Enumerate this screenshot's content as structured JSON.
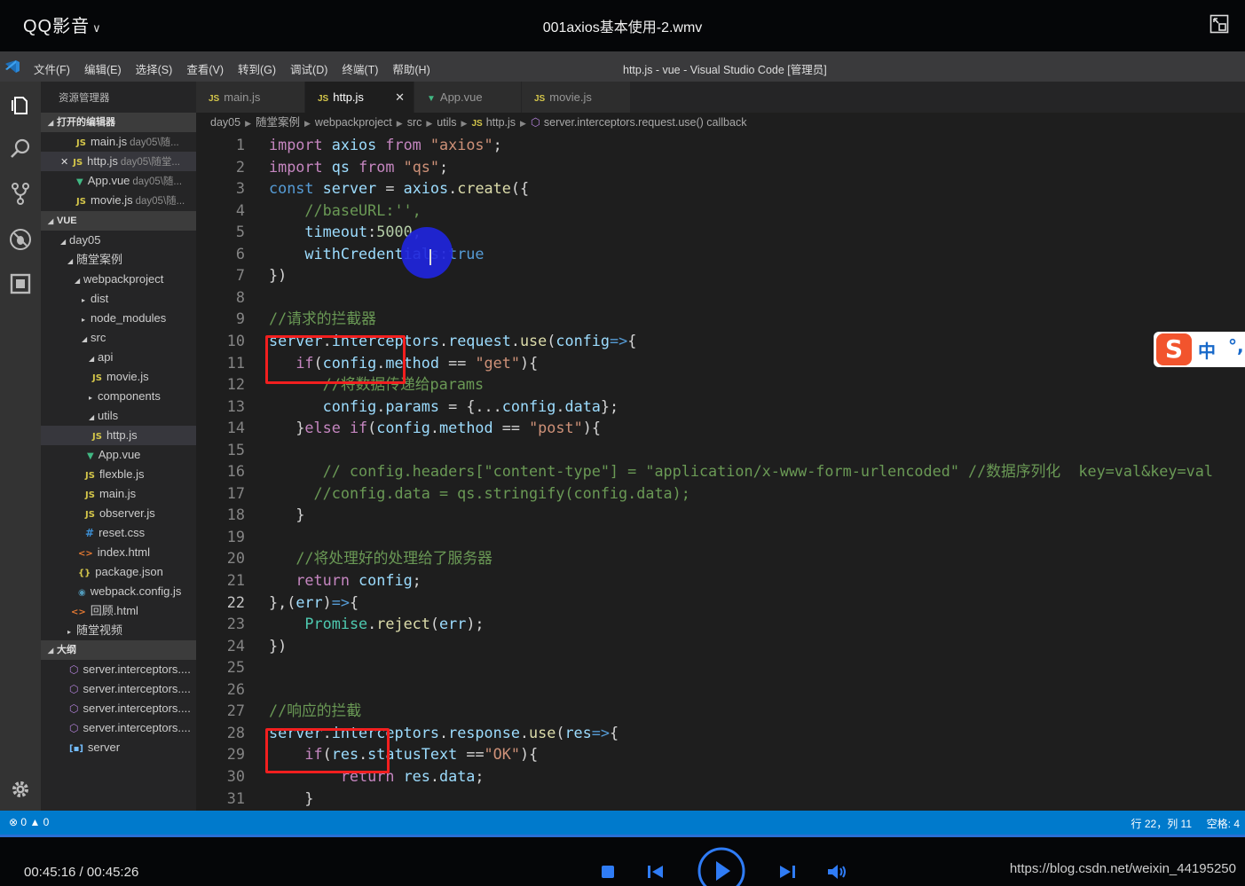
{
  "player": {
    "app_name": "QQ影音",
    "file_title": "001axios基本使用-2.wmv",
    "time_display": "00:45:16 / 00:45:26",
    "watermark": "https://blog.csdn.net/weixin_44195250"
  },
  "vscode": {
    "menu": [
      "文件(F)",
      "编辑(E)",
      "选择(S)",
      "查看(V)",
      "转到(G)",
      "调试(D)",
      "终端(T)",
      "帮助(H)"
    ],
    "window_title": "http.js - vue - Visual Studio Code [管理员]",
    "explorer_title": "资源管理器",
    "sections": {
      "open_editors": "打开的编辑器",
      "vue": "VUE",
      "outline": "大纲"
    },
    "open_editors": [
      {
        "name": "main.js",
        "desc": "day05\\随..."
      },
      {
        "name": "http.js",
        "desc": "day05\\随堂..."
      },
      {
        "name": "App.vue",
        "desc": "day05\\随..."
      },
      {
        "name": "movie.js",
        "desc": "day05\\随..."
      }
    ],
    "tree": [
      "day05",
      "随堂案例",
      "webpackproject",
      "dist",
      "node_modules",
      "src",
      "api",
      "movie.js",
      "components",
      "utils",
      "http.js",
      "App.vue",
      "flexble.js",
      "main.js",
      "observer.js",
      "reset.css",
      "index.html",
      "package.json",
      "webpack.config.js",
      "回顾.html",
      "随堂视频"
    ],
    "outline": [
      "server.interceptors....",
      "server.interceptors....",
      "server.interceptors....",
      "server.interceptors....",
      "server"
    ],
    "tabs": [
      "main.js",
      "http.js",
      "App.vue",
      "movie.js"
    ],
    "breadcrumb": [
      "day05",
      "随堂案例",
      "webpackproject",
      "src",
      "utils",
      "http.js",
      "server.interceptors.request.use() callback"
    ],
    "status": {
      "errors": "0",
      "warnings": "0",
      "position": "行 22，列 11",
      "spaces": "空格: 4"
    },
    "ime": {
      "zh": "中",
      "punct": "°,"
    }
  },
  "code_lines": [
    "import axios from \"axios\";",
    "import qs from \"qs\";",
    "const server = axios.create({",
    "    //baseURL:'',",
    "    timeout:5000,",
    "    withCredentials:true",
    "})",
    "",
    "//请求的拦截器",
    "server.interceptors.request.use(config=>{",
    "   if(config.method == \"get\"){",
    "      //将数据传递给params",
    "      config.params = {...config.data};",
    "   }else if(config.method == \"post\"){",
    "",
    "      // config.headers[\"content-type\"] = \"application/x-www-form-urlencoded\" //数据序列化  key=val&key=val",
    "     //config.data = qs.stringify(config.data);",
    "   }",
    "",
    "   //将处理好的处理给了服务器",
    "   return config;",
    "},(err)=>{",
    "    Promise.reject(err);",
    "})",
    "",
    "",
    "//响应的拦截",
    "server.interceptors.response.use(res=>{",
    "    if(res.statusText ==\"OK\"){",
    "        return res.data;",
    "    }"
  ],
  "line_numbers": [
    "1",
    "2",
    "3",
    "4",
    "5",
    "6",
    "7",
    "8",
    "9",
    "10",
    "11",
    "12",
    "13",
    "14",
    "15",
    "16",
    "17",
    "18",
    "19",
    "20",
    "21",
    "22",
    "23",
    "24",
    "25",
    "26",
    "27",
    "28",
    "29",
    "30",
    "31"
  ],
  "colors": {
    "annotation_box": "#f21f1f",
    "cursor_circle": "#1f25dc",
    "status_bar": "#007acc"
  }
}
